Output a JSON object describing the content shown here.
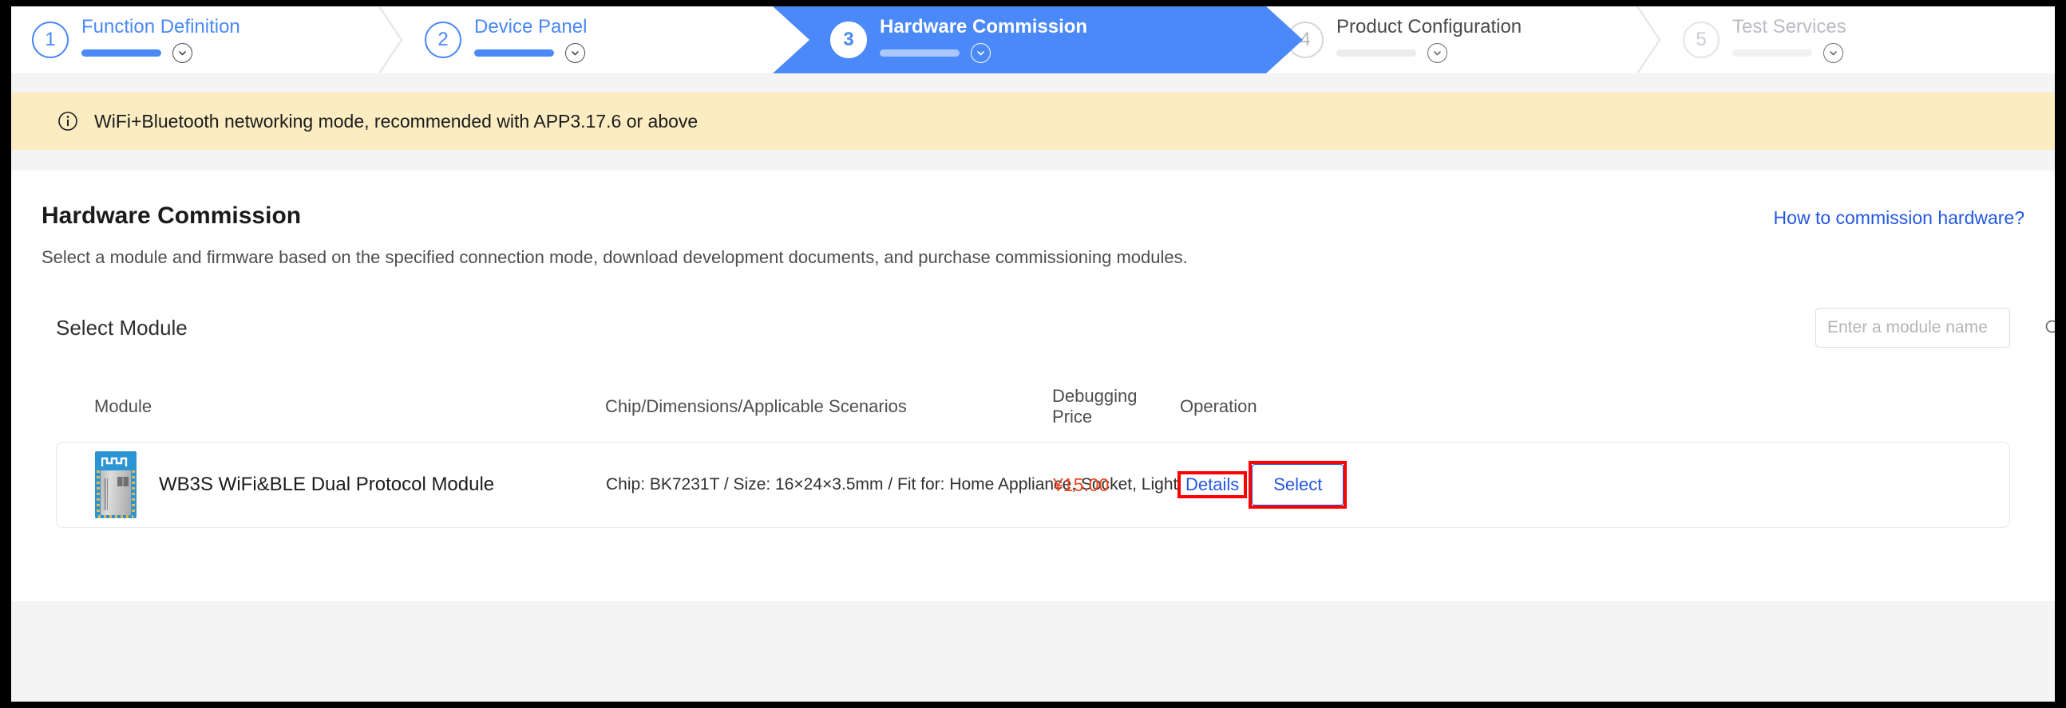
{
  "stepper": {
    "steps": [
      {
        "number": "1",
        "label": "Function Definition",
        "state": "done"
      },
      {
        "number": "2",
        "label": "Device Panel",
        "state": "done"
      },
      {
        "number": "3",
        "label": "Hardware Commission",
        "state": "active"
      },
      {
        "number": "4",
        "label": "Product Configuration",
        "state": "upcoming"
      },
      {
        "number": "5",
        "label": "Test Services",
        "state": "pending"
      }
    ]
  },
  "notice": {
    "icon": "info-circle-icon",
    "text": "WiFi+Bluetooth networking mode, recommended with APP3.17.6 or above"
  },
  "main": {
    "title": "Hardware Commission",
    "help_link": "How to commission hardware?",
    "description": "Select a module and firmware based on the specified connection mode, download development documents, and purchase commissioning modules.",
    "section_title": "Select Module",
    "search": {
      "placeholder": "Enter a module name",
      "value": "",
      "icon": "search-icon"
    },
    "table": {
      "headers": {
        "module": "Module",
        "chip": "Chip/Dimensions/Applicable Scenarios",
        "price": "Debugging Price",
        "operation": "Operation"
      },
      "rows": [
        {
          "module_name": "WB3S WiFi&BLE Dual Protocol Module",
          "module_thumb": "wb3s-module-image",
          "chip": "Chip: BK7231T / Size: 16×24×3.5mm / Fit for: Home Appliance, Socket, Light",
          "price": "¥15.00",
          "details_label": "Details",
          "select_label": "Select"
        }
      ]
    }
  },
  "colors": {
    "accent_blue": "#4a89f7",
    "link_blue": "#2357e0",
    "notice_bg": "#fbecc2",
    "price_red": "#f0451f",
    "annotation_red": "#ff0000",
    "page_bg": "#f4f4f5"
  }
}
